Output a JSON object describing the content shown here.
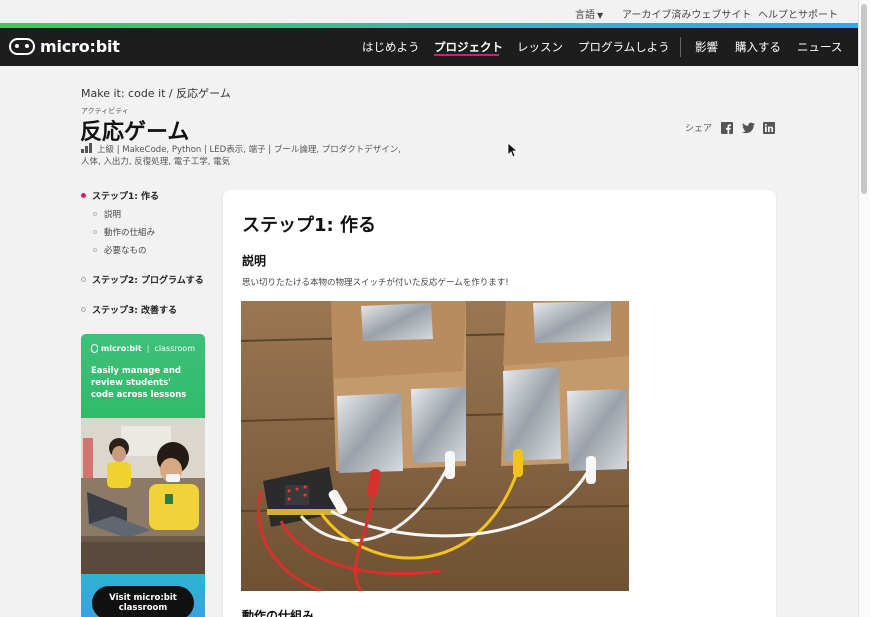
{
  "utility": {
    "language": "言語",
    "archive": "アーカイブ済みウェブサイト",
    "help": "ヘルプとサポート"
  },
  "nav": {
    "brand": "micro:bit",
    "items": [
      {
        "label": "はじめよう"
      },
      {
        "label": "プロジェクト",
        "active": true
      },
      {
        "label": "レッスン"
      },
      {
        "label": "プログラムしよう"
      },
      {
        "label": "影響"
      },
      {
        "label": "購入する"
      },
      {
        "label": "ニュース"
      }
    ]
  },
  "page": {
    "breadcrumb": "Make it: code it / 反応ゲーム",
    "eyebrow": "アクティビティ",
    "title": "反応ゲーム",
    "meta_line1": "上級 | MakeCode, Python | LED表示, 端子 | ブール論理, プロダクトデザイン,",
    "meta_line2": "人体, 入出力, 反復処理, 電子工学, 電気",
    "share_label": "シェア"
  },
  "steps": {
    "step1": "ステップ1: 作る",
    "sub": [
      "説明",
      "動作の仕組み",
      "必要なもの"
    ],
    "step2": "ステップ2: プログラムする",
    "step3": "ステップ3: 改善する"
  },
  "promo": {
    "brand": "micro:bit",
    "brand_sub": "classroom",
    "text": "Easily manage and review students' code across lessons",
    "button_line1": "Visit micro:bit",
    "button_line2": "classroom"
  },
  "content": {
    "title": "ステップ1: 作る",
    "section1_heading": "説明",
    "section1_text": "思い切りたたける本物の物理スイッチが付いた反応ゲームを作ります!",
    "section2_heading": "動作の仕組み"
  },
  "colors": {
    "accent": "#cf1f78",
    "navbar": "#1d1d1d",
    "promo_green": "#3fc07a"
  }
}
